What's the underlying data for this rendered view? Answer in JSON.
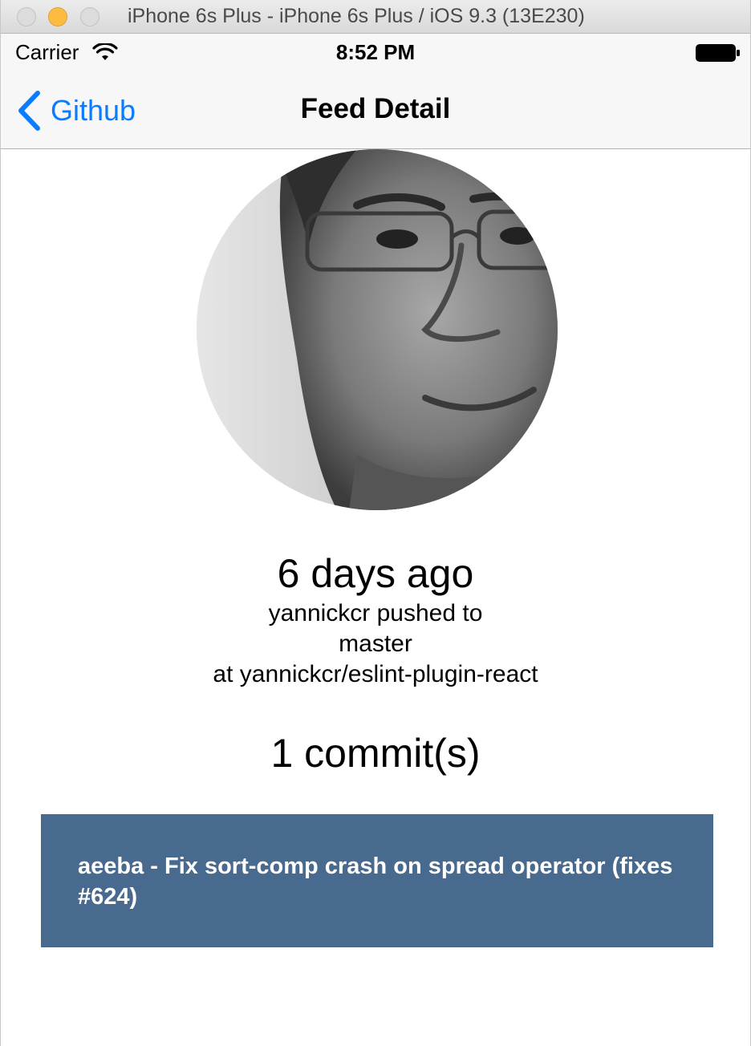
{
  "window": {
    "title": "iPhone 6s Plus - iPhone 6s Plus / iOS 9.3 (13E230)"
  },
  "status_bar": {
    "carrier": "Carrier",
    "time": "8:52 PM"
  },
  "nav_bar": {
    "back_label": "Github",
    "title": "Feed Detail",
    "tint_color": "#0a7cff"
  },
  "feed": {
    "time_ago": "6 days ago",
    "action_line": "yannickcr pushed to",
    "branch_line": "master",
    "repo_line": "at yannickcr/eslint-plugin-react",
    "commit_count": "1 commit(s)"
  },
  "commits": [
    {
      "message": "aeeba - Fix sort-comp crash on spread operator (fixes #624)",
      "background": "#496a8f"
    }
  ],
  "icons": {
    "back": "chevron-left-icon",
    "wifi": "wifi-icon",
    "battery": "battery-icon",
    "avatar": "user-avatar"
  }
}
